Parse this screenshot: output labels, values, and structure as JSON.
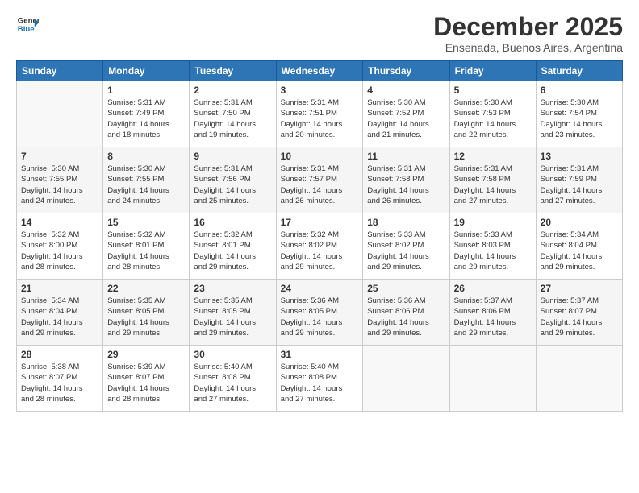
{
  "logo": {
    "line1": "General",
    "line2": "Blue"
  },
  "title": "December 2025",
  "subtitle": "Ensenada, Buenos Aires, Argentina",
  "header_days": [
    "Sunday",
    "Monday",
    "Tuesday",
    "Wednesday",
    "Thursday",
    "Friday",
    "Saturday"
  ],
  "weeks": [
    [
      {
        "day": "",
        "info": ""
      },
      {
        "day": "1",
        "info": "Sunrise: 5:31 AM\nSunset: 7:49 PM\nDaylight: 14 hours\nand 18 minutes."
      },
      {
        "day": "2",
        "info": "Sunrise: 5:31 AM\nSunset: 7:50 PM\nDaylight: 14 hours\nand 19 minutes."
      },
      {
        "day": "3",
        "info": "Sunrise: 5:31 AM\nSunset: 7:51 PM\nDaylight: 14 hours\nand 20 minutes."
      },
      {
        "day": "4",
        "info": "Sunrise: 5:30 AM\nSunset: 7:52 PM\nDaylight: 14 hours\nand 21 minutes."
      },
      {
        "day": "5",
        "info": "Sunrise: 5:30 AM\nSunset: 7:53 PM\nDaylight: 14 hours\nand 22 minutes."
      },
      {
        "day": "6",
        "info": "Sunrise: 5:30 AM\nSunset: 7:54 PM\nDaylight: 14 hours\nand 23 minutes."
      }
    ],
    [
      {
        "day": "7",
        "info": "Sunrise: 5:30 AM\nSunset: 7:55 PM\nDaylight: 14 hours\nand 24 minutes."
      },
      {
        "day": "8",
        "info": "Sunrise: 5:30 AM\nSunset: 7:55 PM\nDaylight: 14 hours\nand 24 minutes."
      },
      {
        "day": "9",
        "info": "Sunrise: 5:31 AM\nSunset: 7:56 PM\nDaylight: 14 hours\nand 25 minutes."
      },
      {
        "day": "10",
        "info": "Sunrise: 5:31 AM\nSunset: 7:57 PM\nDaylight: 14 hours\nand 26 minutes."
      },
      {
        "day": "11",
        "info": "Sunrise: 5:31 AM\nSunset: 7:58 PM\nDaylight: 14 hours\nand 26 minutes."
      },
      {
        "day": "12",
        "info": "Sunrise: 5:31 AM\nSunset: 7:58 PM\nDaylight: 14 hours\nand 27 minutes."
      },
      {
        "day": "13",
        "info": "Sunrise: 5:31 AM\nSunset: 7:59 PM\nDaylight: 14 hours\nand 27 minutes."
      }
    ],
    [
      {
        "day": "14",
        "info": "Sunrise: 5:32 AM\nSunset: 8:00 PM\nDaylight: 14 hours\nand 28 minutes."
      },
      {
        "day": "15",
        "info": "Sunrise: 5:32 AM\nSunset: 8:01 PM\nDaylight: 14 hours\nand 28 minutes."
      },
      {
        "day": "16",
        "info": "Sunrise: 5:32 AM\nSunset: 8:01 PM\nDaylight: 14 hours\nand 29 minutes."
      },
      {
        "day": "17",
        "info": "Sunrise: 5:32 AM\nSunset: 8:02 PM\nDaylight: 14 hours\nand 29 minutes."
      },
      {
        "day": "18",
        "info": "Sunrise: 5:33 AM\nSunset: 8:02 PM\nDaylight: 14 hours\nand 29 minutes."
      },
      {
        "day": "19",
        "info": "Sunrise: 5:33 AM\nSunset: 8:03 PM\nDaylight: 14 hours\nand 29 minutes."
      },
      {
        "day": "20",
        "info": "Sunrise: 5:34 AM\nSunset: 8:04 PM\nDaylight: 14 hours\nand 29 minutes."
      }
    ],
    [
      {
        "day": "21",
        "info": "Sunrise: 5:34 AM\nSunset: 8:04 PM\nDaylight: 14 hours\nand 29 minutes."
      },
      {
        "day": "22",
        "info": "Sunrise: 5:35 AM\nSunset: 8:05 PM\nDaylight: 14 hours\nand 29 minutes."
      },
      {
        "day": "23",
        "info": "Sunrise: 5:35 AM\nSunset: 8:05 PM\nDaylight: 14 hours\nand 29 minutes."
      },
      {
        "day": "24",
        "info": "Sunrise: 5:36 AM\nSunset: 8:05 PM\nDaylight: 14 hours\nand 29 minutes."
      },
      {
        "day": "25",
        "info": "Sunrise: 5:36 AM\nSunset: 8:06 PM\nDaylight: 14 hours\nand 29 minutes."
      },
      {
        "day": "26",
        "info": "Sunrise: 5:37 AM\nSunset: 8:06 PM\nDaylight: 14 hours\nand 29 minutes."
      },
      {
        "day": "27",
        "info": "Sunrise: 5:37 AM\nSunset: 8:07 PM\nDaylight: 14 hours\nand 29 minutes."
      }
    ],
    [
      {
        "day": "28",
        "info": "Sunrise: 5:38 AM\nSunset: 8:07 PM\nDaylight: 14 hours\nand 28 minutes."
      },
      {
        "day": "29",
        "info": "Sunrise: 5:39 AM\nSunset: 8:07 PM\nDaylight: 14 hours\nand 28 minutes."
      },
      {
        "day": "30",
        "info": "Sunrise: 5:40 AM\nSunset: 8:08 PM\nDaylight: 14 hours\nand 27 minutes."
      },
      {
        "day": "31",
        "info": "Sunrise: 5:40 AM\nSunset: 8:08 PM\nDaylight: 14 hours\nand 27 minutes."
      },
      {
        "day": "",
        "info": ""
      },
      {
        "day": "",
        "info": ""
      },
      {
        "day": "",
        "info": ""
      }
    ]
  ]
}
